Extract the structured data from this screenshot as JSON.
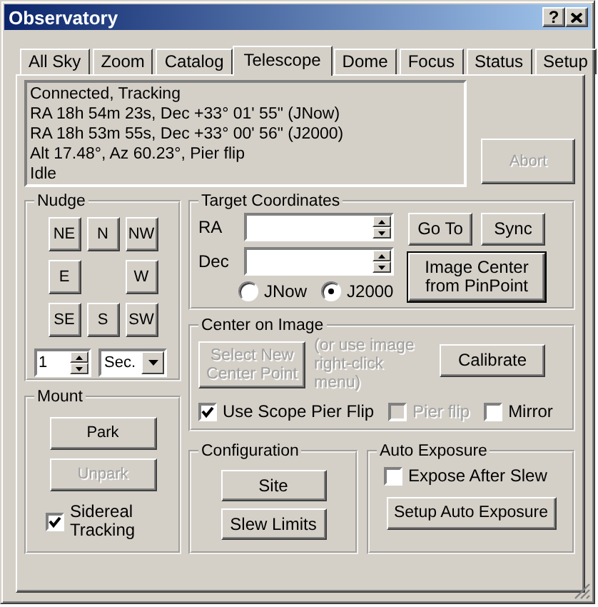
{
  "window": {
    "title": "Observatory",
    "help_button": "?"
  },
  "tabs": [
    {
      "label": "All Sky",
      "selected": false
    },
    {
      "label": "Zoom",
      "selected": false
    },
    {
      "label": "Catalog",
      "selected": false
    },
    {
      "label": "Telescope",
      "selected": true
    },
    {
      "label": "Dome",
      "selected": false
    },
    {
      "label": "Focus",
      "selected": false
    },
    {
      "label": "Status",
      "selected": false
    },
    {
      "label": "Setup",
      "selected": false
    }
  ],
  "status_lines": [
    "Connected, Tracking",
    "RA 18h 54m 23s, Dec +33° 01' 55\" (JNow)",
    "RA 18h 53m 55s, Dec +33° 00' 56\" (J2000)",
    "Alt 17.48°, Az 60.23°, Pier flip",
    "Idle"
  ],
  "abort_button": {
    "label": "Abort",
    "disabled": true
  },
  "nudge": {
    "title": "Nudge",
    "buttons": [
      "NE",
      "N",
      "NW",
      "E",
      "W",
      "SE",
      "S",
      "SW"
    ],
    "step": "1",
    "unit": "Sec."
  },
  "mount": {
    "title": "Mount",
    "buttons": [
      {
        "label": "Park",
        "disabled": false
      },
      {
        "label": "Unpark",
        "disabled": true
      }
    ],
    "sidereal_tracking": {
      "label": "Sidereal Tracking",
      "checked": true
    }
  },
  "target": {
    "title": "Target Coordinates",
    "fields": [
      {
        "label": "RA"
      },
      {
        "label": "Dec"
      }
    ],
    "epochs": [
      {
        "label": "JNow",
        "selected": false
      },
      {
        "label": "J2000",
        "selected": true
      }
    ],
    "buttons": [
      "Go To",
      "Sync"
    ],
    "pinpoint_button": {
      "label": "Image Center from PinPoint",
      "default": true
    }
  },
  "center_on_image": {
    "title": "Center on Image",
    "select_button": {
      "label": "Select New Center Point",
      "disabled": true
    },
    "hint": "(or use image right-click menu)",
    "calibrate_button": "Calibrate",
    "checkboxes": [
      {
        "label": "Use Scope Pier Flip",
        "checked": true,
        "disabled": false
      },
      {
        "label": "Pier flip",
        "checked": false,
        "disabled": true
      },
      {
        "label": "Mirror",
        "checked": false,
        "disabled": false
      }
    ]
  },
  "configuration": {
    "title": "Configuration",
    "buttons": [
      "Site",
      "Slew Limits"
    ]
  },
  "auto_exposure": {
    "title": "Auto Exposure",
    "checkbox": {
      "label": "Expose After Slew",
      "checked": false
    },
    "button": "Setup Auto Exposure"
  }
}
